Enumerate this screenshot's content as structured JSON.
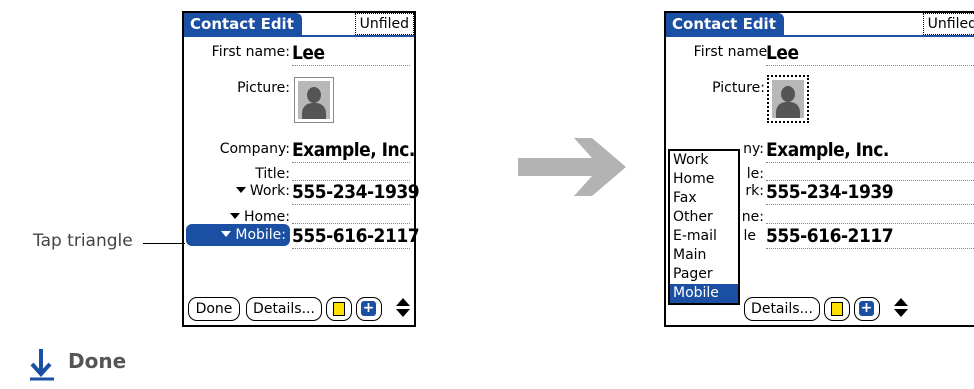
{
  "left_screen": {
    "title": "Contact Edit",
    "category": "Unfiled",
    "fields": {
      "first_name_label": "First name:",
      "first_name_value": "Lee",
      "picture_label": "Picture:",
      "company_label": "Company:",
      "company_value": "Example, Inc.",
      "title_label": "Title:",
      "work_label": "Work:",
      "work_value": "555-234-1939",
      "home_label": "Home:",
      "mobile_label": "Mobile:",
      "mobile_value": "555-616-2117"
    },
    "buttons": {
      "done": "Done",
      "details": "Details..."
    },
    "note_icon": "note-icon",
    "add_icon": "plus-icon"
  },
  "right_screen": {
    "title": "Contact Edit",
    "category": "Unfiled",
    "fields": {
      "first_name_label": "First name:",
      "first_name_value": "Lee",
      "picture_label": "Picture:",
      "company_label_partial": "ny:",
      "company_value": "Example, Inc.",
      "title_label_partial": "le:",
      "work_label_partial": "rk:",
      "work_value": "555-234-1939",
      "home_label_partial": "ne:",
      "mobile_label_partial": "le",
      "mobile_value": "555-616-2117"
    },
    "popup_items": [
      "Work",
      "Home",
      "Fax",
      "Other",
      "E-mail",
      "Main",
      "Pager",
      "Mobile"
    ],
    "popup_selected": "Mobile",
    "buttons": {
      "details": "Details..."
    }
  },
  "callout": {
    "text": "Tap triangle"
  },
  "footer": {
    "done_text": "Done"
  },
  "colors": {
    "accent": "#1a4fa3",
    "arrow": "#b3b3b3"
  }
}
